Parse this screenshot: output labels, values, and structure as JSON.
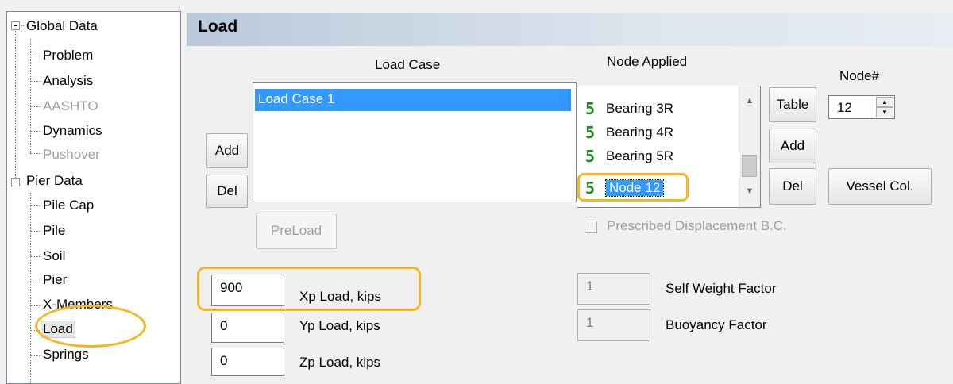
{
  "tree": {
    "groups": [
      {
        "label": "Global Data",
        "children": [
          {
            "label": "Problem",
            "disabled": false
          },
          {
            "label": "Analysis",
            "disabled": false
          },
          {
            "label": "AASHTO",
            "disabled": true
          },
          {
            "label": "Dynamics",
            "disabled": false
          },
          {
            "label": "Pushover",
            "disabled": true
          }
        ]
      },
      {
        "label": "Pier Data",
        "children": [
          {
            "label": "Pile Cap",
            "disabled": false
          },
          {
            "label": "Pile",
            "disabled": false
          },
          {
            "label": "Soil",
            "disabled": false
          },
          {
            "label": "Pier",
            "disabled": false
          },
          {
            "label": "X-Members",
            "disabled": false
          },
          {
            "label": "Load",
            "disabled": false,
            "selected": true
          },
          {
            "label": "Springs",
            "disabled": false
          }
        ]
      }
    ]
  },
  "header": {
    "title": "Load"
  },
  "load_case": {
    "heading": "Load Case",
    "items": [
      "Load Case 1"
    ],
    "add_label": "Add",
    "del_label": "Del",
    "preload_label": "PreLoad"
  },
  "node_applied": {
    "heading": "Node Applied",
    "icon": "support-s-icon",
    "items": [
      "Bearing 3R",
      "Bearing 4R",
      "Bearing 5R",
      "Node 12"
    ],
    "selected": "Node 12",
    "table_label": "Table",
    "add_label": "Add",
    "del_label": "Del",
    "vessel_label": "Vessel Col.",
    "node_number_label": "Node#",
    "node_number_value": "12",
    "prescribed_label": "Prescribed Displacement B.C."
  },
  "loads": [
    {
      "value": "900",
      "label": "Xp Load, kips"
    },
    {
      "value": "0",
      "label": "Yp Load, kips"
    },
    {
      "value": "0",
      "label": "Zp Load, kips"
    }
  ],
  "factors": [
    {
      "value": "1",
      "label": "Self Weight Factor"
    },
    {
      "value": "1",
      "label": "Buoyancy Factor"
    }
  ],
  "colors": {
    "highlight": "#f7b51f",
    "selection": "#3399ff",
    "icon_green": "#1e8a1e"
  }
}
